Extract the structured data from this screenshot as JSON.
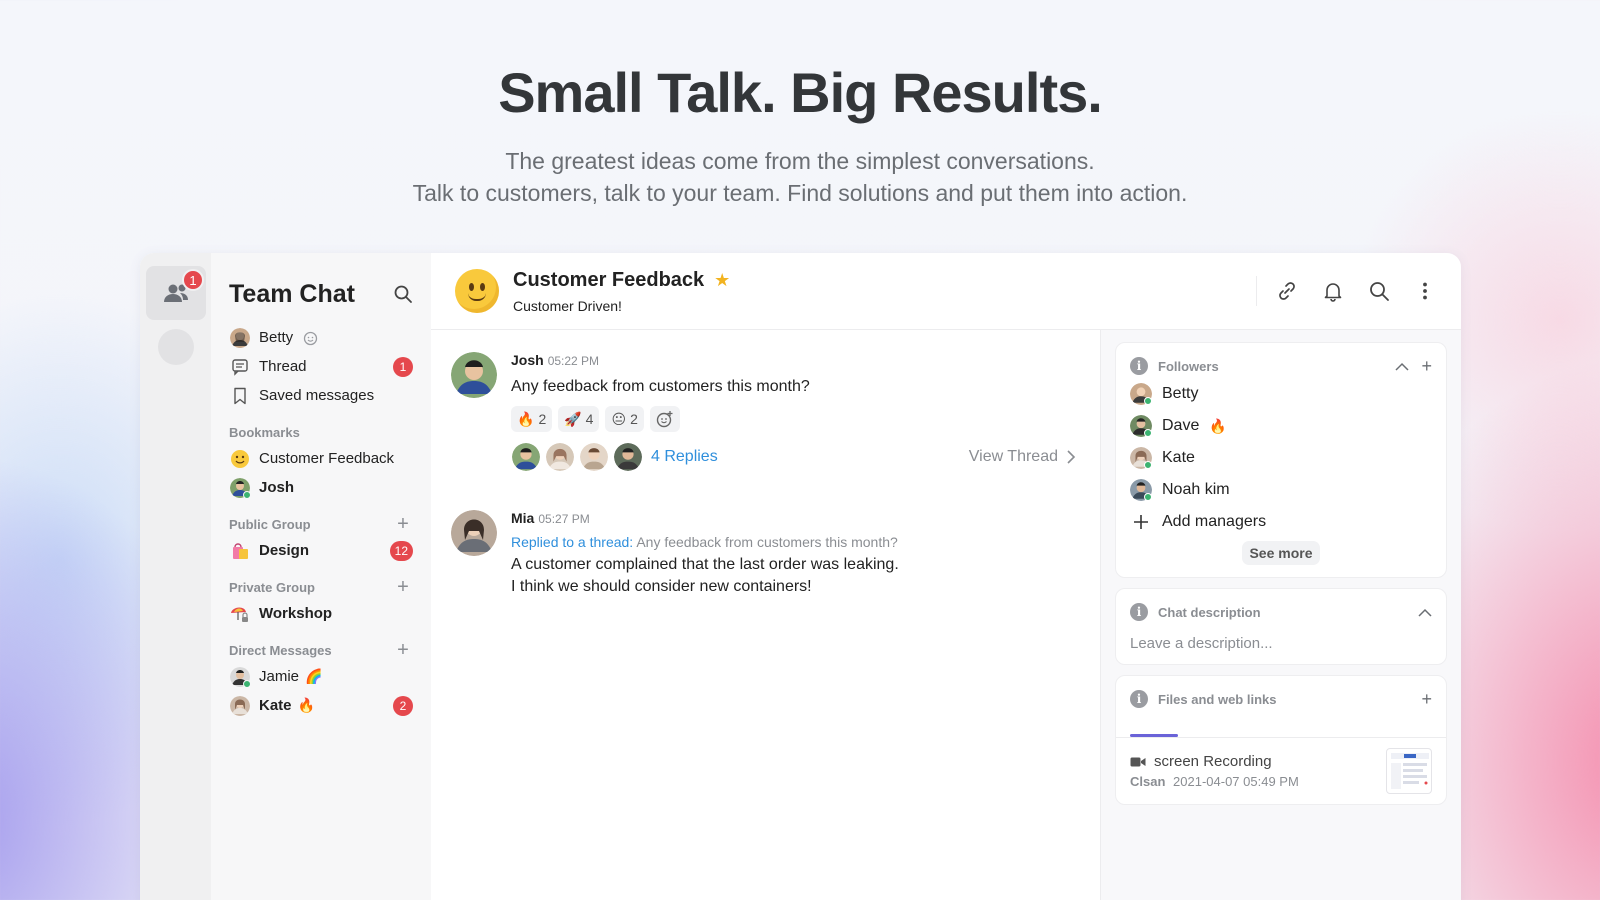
{
  "hero": {
    "title": "Small Talk. Big Results.",
    "line1": "The greatest ideas come from the simplest conversations.",
    "line2": "Talk to customers, talk to your team. Find solutions and put them into action."
  },
  "rail": {
    "home_badge": "1",
    "home_icon": "people-icon"
  },
  "sidebar": {
    "title": "Team Chat",
    "top_items": [
      {
        "label": "Betty",
        "icon": "avatar"
      },
      {
        "label": "Thread",
        "icon": "thread-icon",
        "badge": "1"
      },
      {
        "label": "Saved messages",
        "icon": "bookmark-icon"
      }
    ],
    "sections": {
      "bookmarks": {
        "label": "Bookmarks",
        "items": [
          {
            "label": "Customer Feedback",
            "icon": "smiley-icon"
          },
          {
            "label": "Josh",
            "icon": "avatar"
          }
        ]
      },
      "public": {
        "label": "Public Group",
        "items": [
          {
            "label": "Design",
            "icon": "shopping-bag-icon",
            "badge": "12"
          }
        ]
      },
      "private": {
        "label": "Private Group",
        "items": [
          {
            "label": "Workshop",
            "icon": "umbrella-lock-icon"
          }
        ]
      },
      "dm": {
        "label": "Direct Messages",
        "items": [
          {
            "label": "Jamie",
            "emoji": "🌈"
          },
          {
            "label": "Kate",
            "emoji": "🔥",
            "badge": "2"
          }
        ]
      }
    }
  },
  "header": {
    "title": "Customer Feedback",
    "subtitle": "Customer Driven!"
  },
  "messages": [
    {
      "name": "Josh",
      "time": "05:22 PM",
      "text": "Any feedback from customers this month?",
      "reactions": [
        {
          "emoji": "🔥",
          "count": "2"
        },
        {
          "emoji": "🚀",
          "count": "4"
        },
        {
          "emoji": "😐",
          "count": "2"
        }
      ],
      "replies": "4 Replies",
      "view_thread": "View Thread"
    },
    {
      "name": "Mia",
      "time": "05:27 PM",
      "replied_prefix": "Replied to a thread:",
      "replied_quote": "Any feedback from customers this month?",
      "line1": "A customer complained that the last order was leaking.",
      "line2": "I think we should consider new containers!"
    }
  ],
  "right": {
    "followers": {
      "label": "Followers",
      "items": [
        {
          "name": "Betty"
        },
        {
          "name": "Dave",
          "emoji": "🔥"
        },
        {
          "name": "Kate"
        },
        {
          "name": "Noah kim"
        }
      ],
      "add": "Add managers",
      "see_more": "See more"
    },
    "description": {
      "label": "Chat description",
      "placeholder": "Leave a description..."
    },
    "files": {
      "label": "Files and web links",
      "item": {
        "name": "screen Recording",
        "who": "Clsan",
        "when": "2021-04-07 05:49 PM"
      }
    }
  },
  "colors": {
    "badge": "#e5484d",
    "link": "#2f8fdc",
    "star": "#f2b320",
    "online": "#3cb371"
  }
}
